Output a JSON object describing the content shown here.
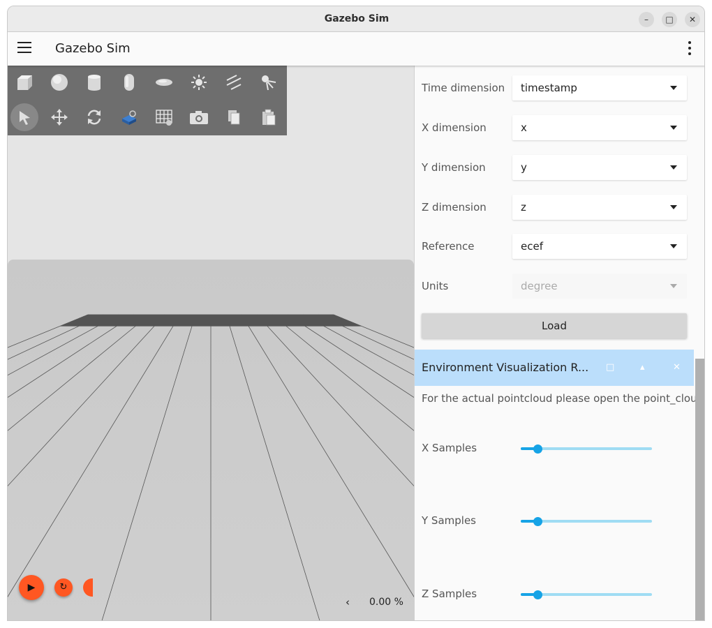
{
  "window": {
    "title": "Gazebo Sim",
    "minimize_icon": "–",
    "maximize_icon": "□",
    "close_icon": "✕"
  },
  "appbar": {
    "title": "Gazebo Sim"
  },
  "toolbar": {
    "row1": [
      "box-icon",
      "sphere-icon",
      "cylinder-icon",
      "capsule-icon",
      "ellipsoid-icon",
      "point-light-icon",
      "directional-light-icon",
      "spot-light-icon"
    ],
    "row2": [
      "select-icon",
      "translate-icon",
      "rotate-icon",
      "transform-control-icon",
      "grid-snap-icon",
      "screenshot-icon",
      "copy-icon",
      "paste-icon"
    ]
  },
  "playback": {
    "play_icon": "▶",
    "step_icon": "↻",
    "rtf_arrow": "‹",
    "rtf_value": "0.00 %"
  },
  "form": {
    "time": {
      "label": "Time dimension",
      "value": "timestamp"
    },
    "x": {
      "label": "X dimension",
      "value": "x"
    },
    "y": {
      "label": "Y dimension",
      "value": "y"
    },
    "z": {
      "label": "Z dimension",
      "value": "z"
    },
    "reference": {
      "label": "Reference",
      "value": "ecef"
    },
    "units": {
      "label": "Units",
      "value": "degree"
    },
    "load_label": "Load"
  },
  "env_viz": {
    "title": "Environment Visualization R...",
    "float_icon": "□",
    "collapse_icon": "▴",
    "close_icon": "✕",
    "description": "For the actual pointcloud please open the point_clou",
    "sliders": [
      {
        "label": "X Samples",
        "value": 0.13
      },
      {
        "label": "Y Samples",
        "value": 0.13
      },
      {
        "label": "Z Samples",
        "value": 0.13
      }
    ]
  },
  "colors": {
    "accent": "#ff5722",
    "header_bg": "#bbdefb",
    "slider": "#16a3e6"
  }
}
